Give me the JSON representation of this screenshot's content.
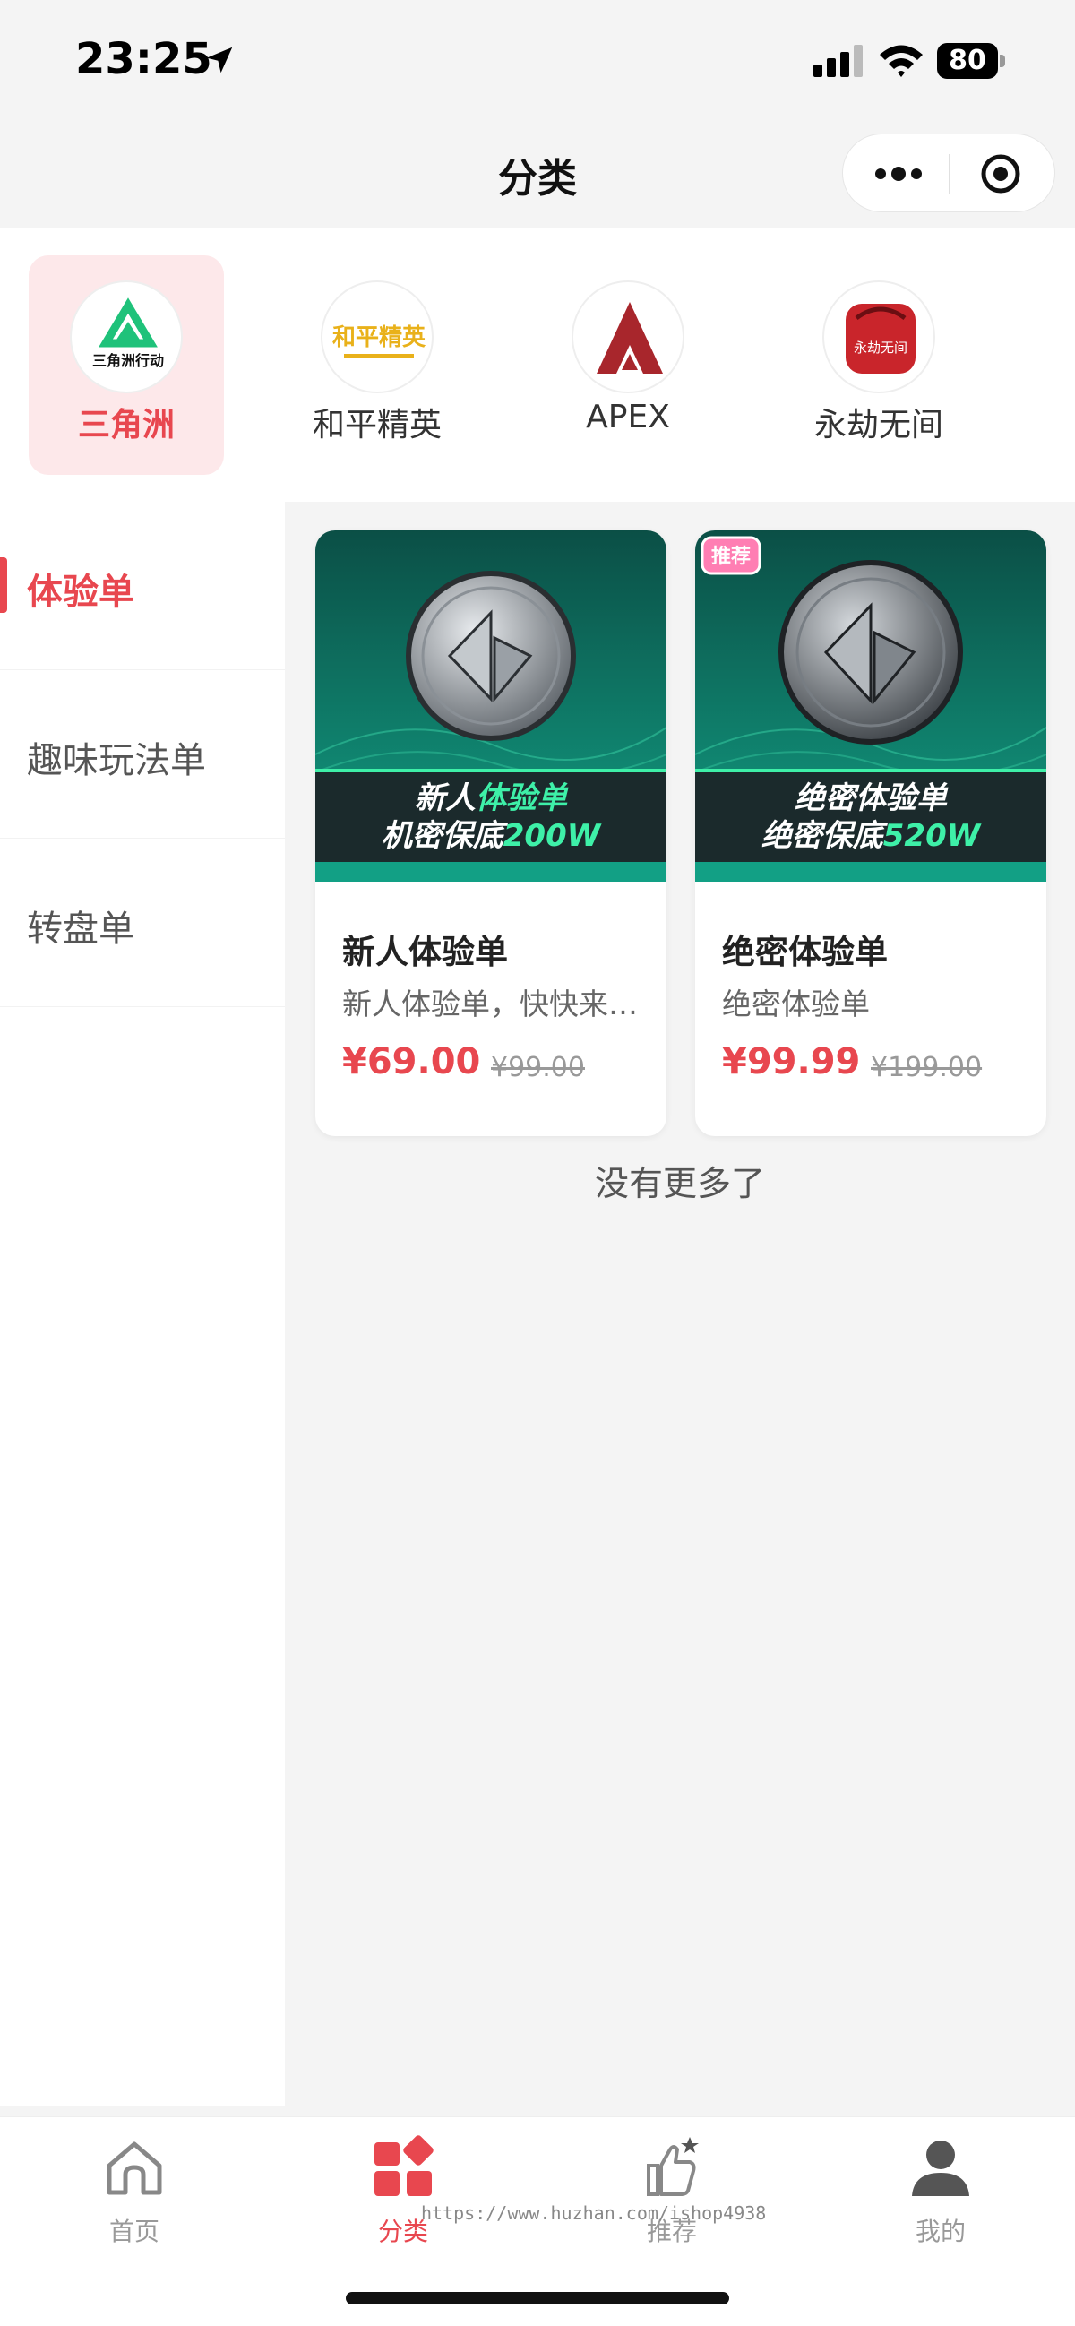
{
  "status_bar": {
    "time": "23:25",
    "battery": "80"
  },
  "nav": {
    "title": "分类"
  },
  "categories": [
    {
      "label": "三角洲",
      "logo_text": "三角洲行动",
      "active": true
    },
    {
      "label": "和平精英",
      "logo_text": "和平精英",
      "active": false
    },
    {
      "label": "APEX",
      "logo_text": "",
      "active": false
    },
    {
      "label": "永劫无间",
      "logo_text": "永劫无间",
      "active": false
    }
  ],
  "sidebar": {
    "items": [
      {
        "label": "体验单",
        "active": true
      },
      {
        "label": "趣味玩法单",
        "active": false
      },
      {
        "label": "转盘单",
        "active": false
      }
    ]
  },
  "products": [
    {
      "banner_line1_a": "新人",
      "banner_line1_b": "体验单",
      "banner_line2_a": "机密保底",
      "banner_line2_b": "200W",
      "title": "新人体验单",
      "desc": "新人体验单，快快来下单吧",
      "price": "¥69.00",
      "original_price": "¥99.00",
      "badge": ""
    },
    {
      "banner_line1_a": "绝密体验单",
      "banner_line1_b": "",
      "banner_line2_a": "绝密保底",
      "banner_line2_b": "520W",
      "title": "绝密体验单",
      "desc": "绝密体验单",
      "price": "¥99.99",
      "original_price": "¥199.00",
      "badge": "推荐"
    }
  ],
  "list_footer": "没有更多了",
  "tabs": [
    {
      "label": "首页",
      "icon": "home-icon",
      "active": false
    },
    {
      "label": "分类",
      "icon": "category-icon",
      "active": true
    },
    {
      "label": "推荐",
      "icon": "thumbs-up-icon",
      "active": false
    },
    {
      "label": "我的",
      "icon": "user-icon",
      "active": false
    }
  ],
  "watermark": "https://www.huzhan.com/ishop4938",
  "colors": {
    "accent": "#e8474f",
    "banner_green": "#0f7a6a",
    "banner_dark": "#1b2a2c",
    "highlight_green": "#3ef0a8"
  }
}
